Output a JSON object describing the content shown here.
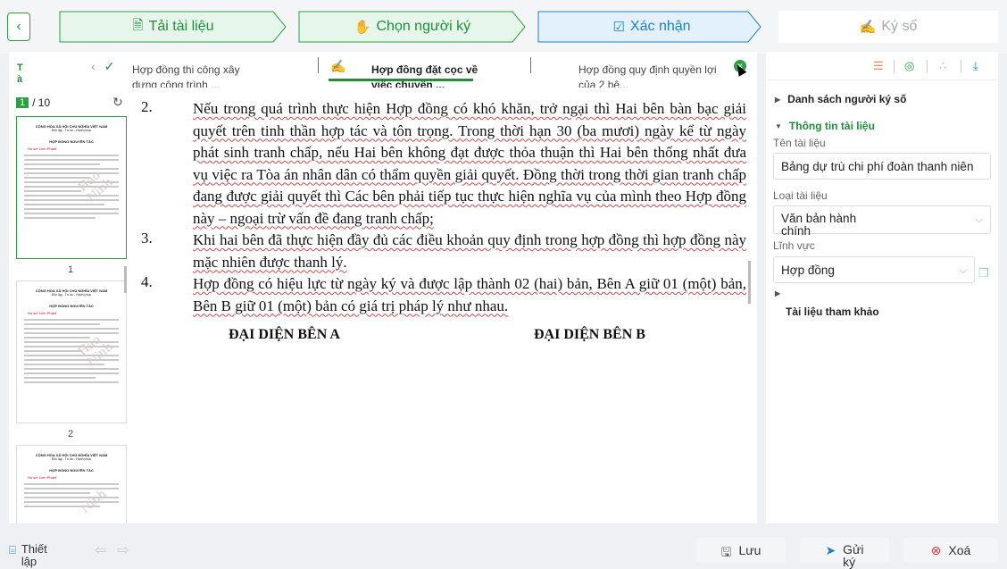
{
  "steps": [
    {
      "label": "Tải tài liệu",
      "icon": "upload-file-icon",
      "state": "done"
    },
    {
      "label": "Chọn người ký",
      "icon": "hand-person-icon",
      "state": "done"
    },
    {
      "label": "Xác nhận",
      "icon": "check-square-icon",
      "state": "active"
    },
    {
      "label": "Ký số",
      "icon": "signature-icon",
      "state": "pending"
    }
  ],
  "doc_tabs": {
    "left_label": "T\nà",
    "items": [
      {
        "label": "Hợp đồng thi công xây\ndựng công trình ..."
      },
      {
        "label": "Hợp đồng đặt cọc về\nviệc chuyển ..."
      },
      {
        "label": "Hợp đồng quy định quyền lợi\ncủa 2 bê..."
      }
    ]
  },
  "pager": {
    "current": "1",
    "total": "/ 10"
  },
  "thumbnails": [
    {
      "page": "1",
      "header": "CỘNG HÒA XÃ HỘI CHỦ NGHĨA VIỆT NAM",
      "subheader": "Độc lập - Tự do - Hạnh phúc",
      "title": "HỢP ĐỒNG NGUYÊN TẮC",
      "red": "Hồ sơ: Linh Phạm",
      "watermark": "Hào Ninh"
    },
    {
      "page": "2",
      "header": "CỘNG HÒA XÃ HỘI CHỦ NGHĨA VIỆT NAM",
      "subheader": "Độc lập - Tự do - Hạnh phúc",
      "title": "HỢP ĐỒNG NGUYÊN TẮC",
      "red": "Hồ sơ: Linh Phạm",
      "watermark": "Hào Ninh"
    },
    {
      "page": "",
      "header": "CỘNG HÒA XÃ HỘI CHỦ NGHĨA VIỆT NAM",
      "subheader": "Độc lập - Tự do - Hạnh phúc",
      "title": "HỢP ĐỒNG NGUYÊN TẮC",
      "red": "Hồ sơ: Linh Phạm",
      "watermark": "Ninh"
    }
  ],
  "document": {
    "items": [
      {
        "num": "2.",
        "text": "Nếu trong quá trình thực hiện Hợp đồng có khó khăn, trở ngại thì Hai bên bàn bạc giải quyết trên tinh thần hợp tác và tôn trọng. Trong thời hạn 30 (ba mươi) ngày kể từ ngày phát sinh tranh chấp, nếu Hai bên không đạt được thỏa thuận thì Hai bên thống nhất đưa vụ việc ra Tòa án nhân dân có thẩm quyền giải quyết. Đồng thời trong thời gian tranh chấp đang được giải quyết thì Các bên phải tiếp tục thực hiện nghĩa vụ của mình theo Hợp đồng này – ngoại trừ vấn đề đang tranh chấp;"
      },
      {
        "num": "3.",
        "text": "Khi hai bên đã thực hiện đầy đủ các điều khoản quy định trong hợp đồng thì hợp đồng này mặc nhiên được thanh lý."
      },
      {
        "num": "4.",
        "text": "Hợp đồng có hiệu lực từ ngày ký và được lập thành 02 (hai) bản, Bên A giữ 01 (một) bản, Bên B giữ 01 (một) bản có giá trị pháp lý như nhau."
      }
    ],
    "rep_a": "ĐẠI DIỆN BÊN A",
    "rep_b": "ĐẠI DIỆN BÊN B"
  },
  "right_panel": {
    "signers_section": "Danh sách người ký số",
    "info_section": "Thông tin tài liệu",
    "name_label": "Tên tài liệu",
    "name_value": "Bảng dự trù chi phí đoàn thanh niên",
    "type_label": "Loại tài liệu",
    "type_value": "Văn bản hành\nchính",
    "field_label": "Lĩnh vực",
    "field_value": "Hợp đồng",
    "refs_section": "Tài liệu tham khảo"
  },
  "bottom": {
    "setup": "Thiết\nlập",
    "save": "Lưu",
    "send": "Gửi\nký",
    "delete": "Xoá"
  },
  "colors": {
    "green": "#1f8f3a",
    "blue": "#1e7fc8",
    "red": "#e04040"
  }
}
